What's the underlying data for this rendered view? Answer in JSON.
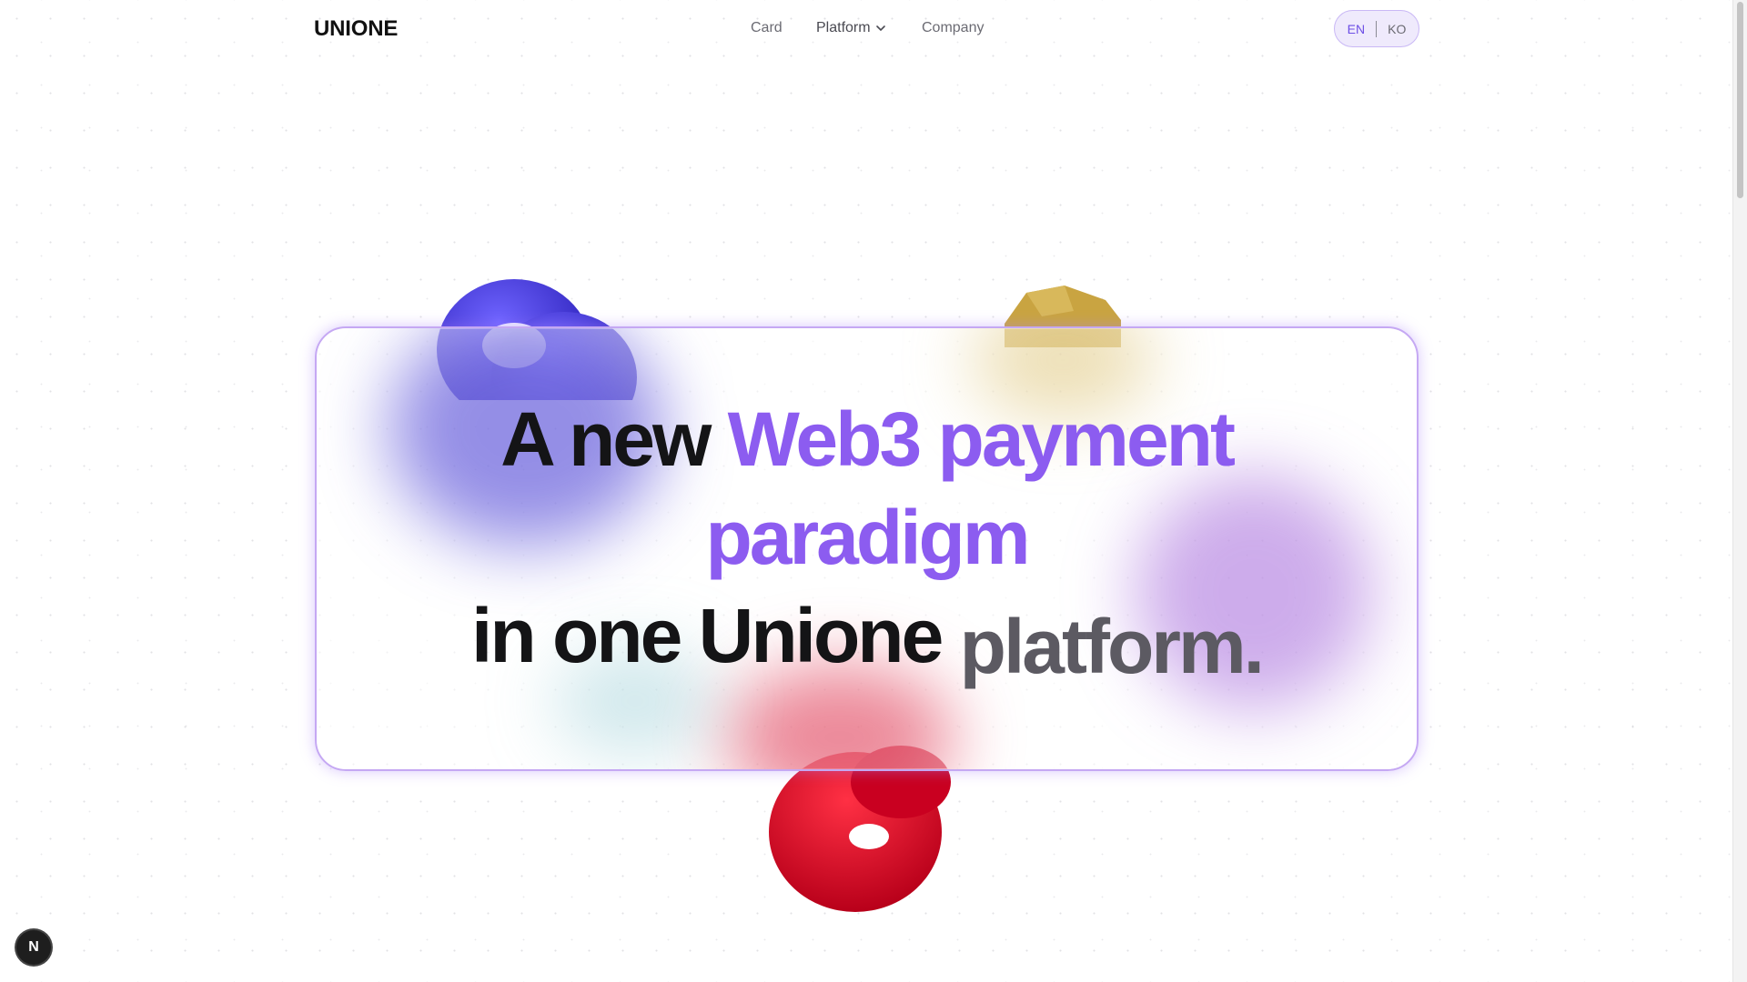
{
  "header": {
    "logo": "UNIONE",
    "nav": {
      "card": "Card",
      "platform": "Platform",
      "company": "Company"
    },
    "lang": {
      "en": "EN",
      "ko": "KO",
      "active": "EN"
    }
  },
  "hero": {
    "line1_dark": "A new ",
    "line1_purple": "Web3 payment",
    "line2_purple": "paradigm",
    "line3_dark": "in one Unione ",
    "line3_grey": "platform."
  },
  "fab": {
    "label": "N"
  },
  "colors": {
    "accent": "#8c5cf0",
    "text": "#141416",
    "muted": "#5c5a62",
    "lang_bg": "#efeafc",
    "card_border": "#c5a8f3"
  },
  "icons": {
    "platform_dropdown": "chevron-down-icon",
    "fab": "next-logo-icon"
  }
}
